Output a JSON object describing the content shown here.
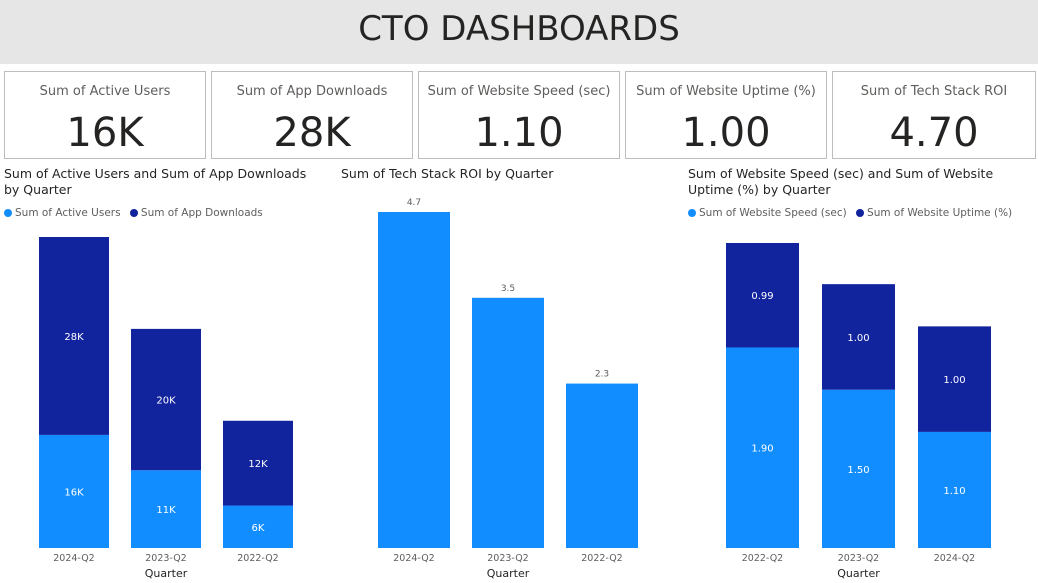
{
  "title": "CTO DASHBOARDS",
  "colors": {
    "light_blue": "#118dff",
    "dark_blue": "#12239e",
    "header_bg": "#e6e6e6"
  },
  "cards": [
    {
      "label": "Sum of Active Users",
      "value": "16K"
    },
    {
      "label": "Sum of App Downloads",
      "value": "28K"
    },
    {
      "label": "Sum of Website Speed (sec)",
      "value": "1.10"
    },
    {
      "label": "Sum of Website Uptime (%)",
      "value": "1.00"
    },
    {
      "label": "Sum of Tech Stack ROI",
      "value": "4.70"
    }
  ],
  "chart_data": [
    {
      "type": "bar",
      "stacked": true,
      "title": "Sum of Active Users and Sum of App Downloads by Quarter",
      "xlabel": "Quarter",
      "categories": [
        "2024-Q2",
        "2023-Q2",
        "2022-Q2"
      ],
      "series": [
        {
          "name": "Sum of Active Users",
          "values": [
            16000,
            11000,
            6000
          ],
          "labels": [
            "16K",
            "11K",
            "6K"
          ]
        },
        {
          "name": "Sum of App Downloads",
          "values": [
            28000,
            20000,
            12000
          ],
          "labels": [
            "28K",
            "20K",
            "12K"
          ]
        }
      ],
      "legend": "top-left"
    },
    {
      "type": "bar",
      "title": "Sum of Tech Stack ROI by Quarter",
      "xlabel": "Quarter",
      "categories": [
        "2024-Q2",
        "2023-Q2",
        "2022-Q2"
      ],
      "series": [
        {
          "name": "Sum of Tech Stack ROI",
          "values": [
            4.7,
            3.5,
            2.3
          ],
          "labels": [
            "4.7",
            "3.5",
            "2.3"
          ]
        }
      ]
    },
    {
      "type": "bar",
      "stacked": true,
      "title": "Sum of Website Speed (sec) and Sum of Website Uptime (%) by Quarter",
      "xlabel": "Quarter",
      "categories": [
        "2022-Q2",
        "2023-Q2",
        "2024-Q2"
      ],
      "series": [
        {
          "name": "Sum of Website Speed (sec)",
          "values": [
            1.9,
            1.5,
            1.1
          ],
          "labels": [
            "1.90",
            "1.50",
            "1.10"
          ]
        },
        {
          "name": "Sum of Website Uptime (%)",
          "values": [
            0.99,
            1.0,
            1.0
          ],
          "labels": [
            "0.99",
            "1.00",
            "1.00"
          ]
        }
      ],
      "legend": "top-left"
    }
  ]
}
